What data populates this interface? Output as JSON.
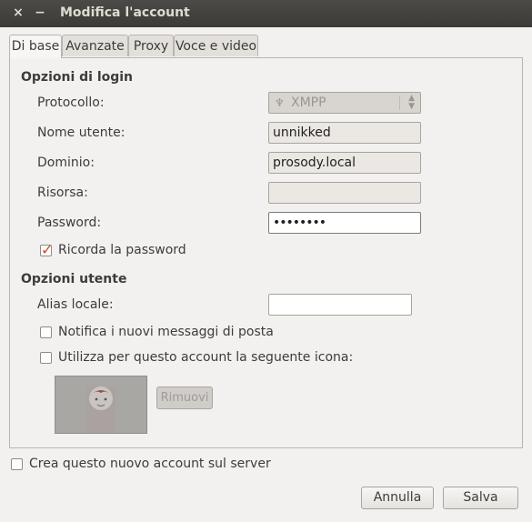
{
  "window": {
    "title": "Modifica l'account",
    "close_glyph": "×",
    "minimize_glyph": "−"
  },
  "tabs": [
    {
      "label": "Di base",
      "active": true
    },
    {
      "label": "Avanzate",
      "active": false
    },
    {
      "label": "Proxy",
      "active": false
    },
    {
      "label": "Voce e video",
      "active": false
    }
  ],
  "login": {
    "section_title": "Opzioni di login",
    "protocol_label": "Protocollo:",
    "protocol_value": "XMPP",
    "username_label": "Nome utente:",
    "username_value": "unnikked",
    "domain_label": "Dominio:",
    "domain_value": "prosody.local",
    "resource_label": "Risorsa:",
    "resource_value": "",
    "password_label": "Password:",
    "password_value": "••••••••",
    "remember_label": "Ricorda la password",
    "remember_checked": true
  },
  "user": {
    "section_title": "Opzioni utente",
    "alias_label": "Alias locale:",
    "alias_value": "",
    "notify_label": "Notifica i nuovi messaggi di posta",
    "notify_checked": false,
    "icon_label": "Utilizza per questo account la seguente icona:",
    "icon_checked": false,
    "remove_label": "Rimuovi"
  },
  "footer": {
    "create_label": "Crea questo nuovo account sul server",
    "create_checked": false,
    "cancel_label": "Annulla",
    "save_label": "Salva"
  },
  "colors": {
    "check_accent": "#c74e2b",
    "titlebar": "#3c3b37"
  }
}
